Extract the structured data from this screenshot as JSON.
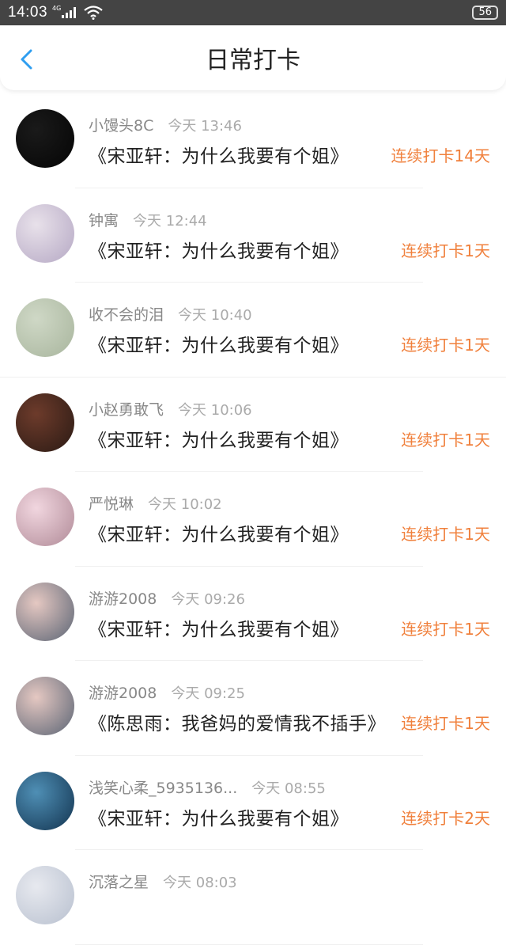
{
  "status_bar": {
    "time": "14:03",
    "network": "4G",
    "battery": "56"
  },
  "header": {
    "title": "日常打卡"
  },
  "items": [
    {
      "name": "小馒头8C",
      "time": "今天 13:46",
      "book": "《宋亚轩：为什么我要有个姐》",
      "streak": "连续打卡14天",
      "avatar_colors": [
        "#1a1a1a",
        "#050505"
      ]
    },
    {
      "name": "钟寓",
      "time": "今天 12:44",
      "book": "《宋亚轩：为什么我要有个姐》",
      "streak": "连续打卡1天",
      "avatar_colors": [
        "#e8e1ea",
        "#b5a8c4"
      ]
    },
    {
      "name": "收不会的泪",
      "time": "今天 10:40",
      "book": "《宋亚轩：为什么我要有个姐》",
      "streak": "连续打卡1天",
      "avatar_colors": [
        "#cfd8c6",
        "#a8b59d"
      ]
    },
    {
      "name": "小赵勇敢飞",
      "time": "今天 10:06",
      "book": "《宋亚轩：为什么我要有个姐》",
      "streak": "连续打卡1天",
      "avatar_colors": [
        "#6d3b2b",
        "#2a1a14"
      ]
    },
    {
      "name": "严悦琳",
      "time": "今天 10:02",
      "book": "《宋亚轩：为什么我要有个姐》",
      "streak": "连续打卡1天",
      "avatar_colors": [
        "#f1d6df",
        "#b08a97"
      ]
    },
    {
      "name": "游游2008",
      "time": "今天 09:26",
      "book": "《宋亚轩：为什么我要有个姐》",
      "streak": "连续打卡1天",
      "avatar_colors": [
        "#e5c8c2",
        "#5a6474"
      ]
    },
    {
      "name": "游游2008",
      "time": "今天 09:25",
      "book": "《陈思雨：我爸妈的爱情我不插手》",
      "streak": "连续打卡1天",
      "avatar_colors": [
        "#e5c8c2",
        "#5a6474"
      ]
    },
    {
      "name": "浅笑心柔_5935136...",
      "time": "今天 08:55",
      "book": "《宋亚轩：为什么我要有个姐》",
      "streak": "连续打卡2天",
      "avatar_colors": [
        "#4f8fb5",
        "#12334f"
      ]
    },
    {
      "name": "沉落之星",
      "time": "今天 08:03",
      "book": "",
      "streak": "",
      "avatar_colors": [
        "#e7e9ef",
        "#b8c0cf"
      ]
    }
  ]
}
